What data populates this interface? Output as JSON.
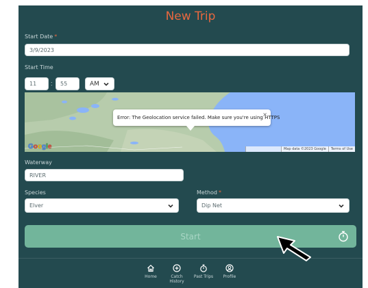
{
  "title": "New Trip",
  "start_date": {
    "label": "Start Date",
    "required": "*",
    "value": "3/9/2023"
  },
  "start_time": {
    "label": "Start Time",
    "hour": "11",
    "separator": ":",
    "minute": "55",
    "ampm": "AM"
  },
  "map": {
    "info_text": "Error: The Geolocation service failed. Make sure you're using HTTPS",
    "close_symbol": "×",
    "logo_letters": [
      "G",
      "o",
      "o",
      "g",
      "l",
      "e"
    ],
    "footer_data": "Map data ©2023 Google",
    "footer_terms": "Terms of Use"
  },
  "waterway": {
    "label": "Waterway",
    "value": "RIVER"
  },
  "species": {
    "label": "Species",
    "value": "Elver"
  },
  "method": {
    "label": "Method",
    "required": "*",
    "value": "Dip Net"
  },
  "start_button": {
    "label": "Start"
  },
  "nav": {
    "items": [
      {
        "label": "Home",
        "icon": "home-icon"
      },
      {
        "label": "Catch History",
        "icon": "plus-circle-icon"
      },
      {
        "label": "Past Trips",
        "icon": "stopwatch-icon"
      },
      {
        "label": "Profile",
        "icon": "profile-icon"
      }
    ]
  },
  "colors": {
    "background": "#234a4f",
    "accent": "#e8683f",
    "button": "#72b59b",
    "map_water": "#8ab4f8"
  }
}
